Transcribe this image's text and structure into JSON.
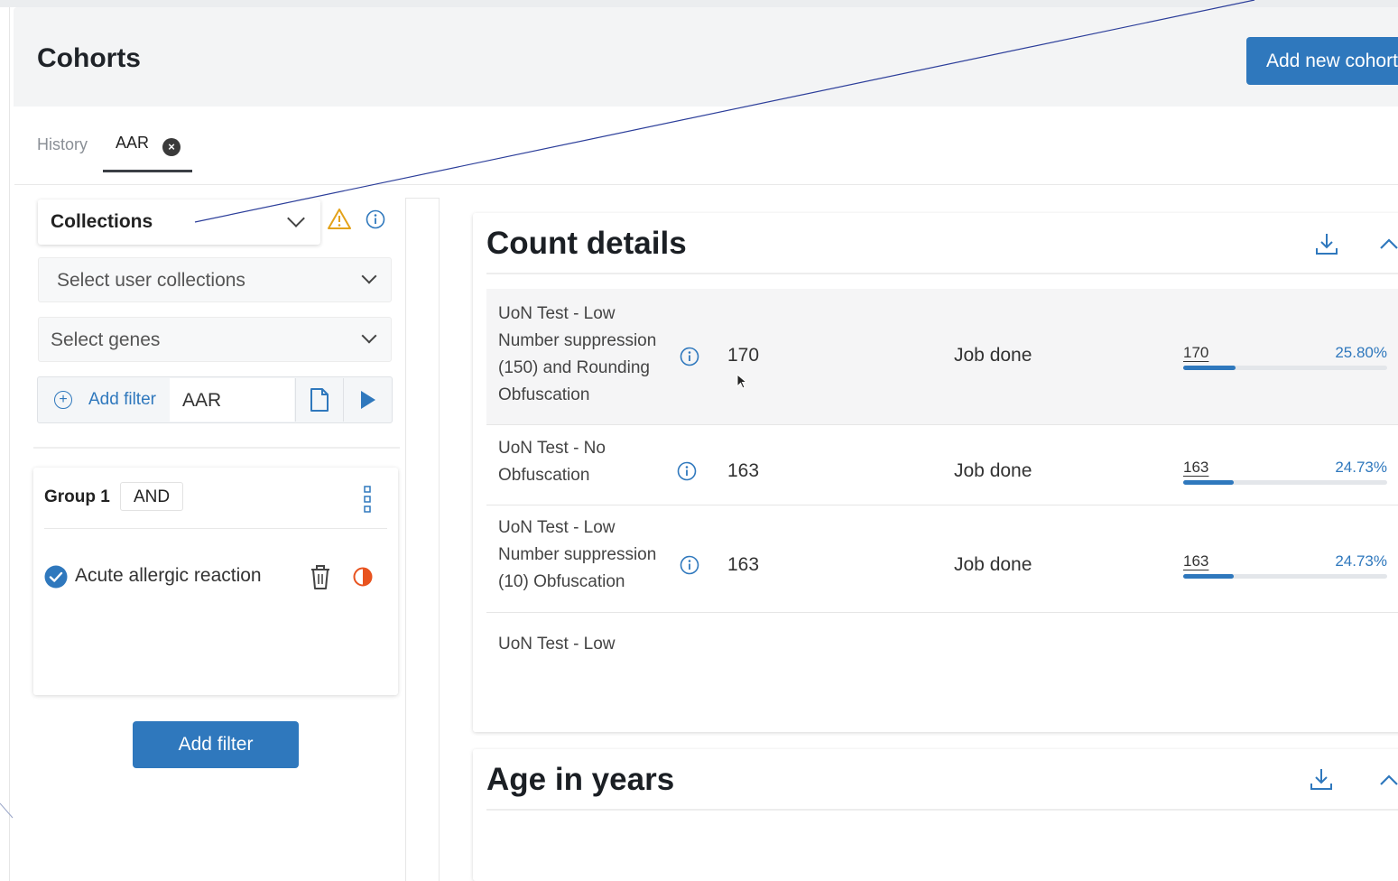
{
  "header": {
    "title": "Cohorts",
    "add_cohort_label": "Add new cohort"
  },
  "tabs": [
    {
      "label": "History",
      "active": false
    },
    {
      "label": "AAR",
      "active": true,
      "closable": true
    }
  ],
  "left_panel": {
    "collections_label": "Collections",
    "icons": [
      "chevron-down-icon",
      "warning-icon",
      "info-icon"
    ],
    "user_collections_placeholder": "Select user collections",
    "genes_placeholder": "Select genes",
    "add_filter_link": "Add filter",
    "filter_value": "AAR",
    "group": {
      "label": "Group 1",
      "operator": "AND",
      "criteria": [
        {
          "label": "Acute allergic reaction",
          "checked": true
        }
      ]
    },
    "add_filter_button": "Add filter"
  },
  "count_details": {
    "title": "Count details",
    "rows": [
      {
        "name": "UoN Test - Low Number suppression (150) and Rounding Obfuscation",
        "count": "170",
        "status": "Job done",
        "bar_label": "170",
        "percent": "25.80%",
        "fraction": 0.258
      },
      {
        "name": "UoN Test - No Obfuscation",
        "count": "163",
        "status": "Job done",
        "bar_label": "163",
        "percent": "24.73%",
        "fraction": 0.2473
      },
      {
        "name": "UoN Test - Low Number suppression (10) Obfuscation",
        "count": "163",
        "status": "Job done",
        "bar_label": "163",
        "percent": "24.73%",
        "fraction": 0.2473
      },
      {
        "name": "UoN Test - Low",
        "count": "",
        "status": "",
        "bar_label": "",
        "percent": "",
        "fraction": 0
      }
    ]
  },
  "age_card": {
    "title": "Age in years"
  },
  "colors": {
    "accent": "#2f78bd",
    "warning": "#e3a21a",
    "remove": "#e8531f",
    "header_bg": "#f3f4f5"
  }
}
